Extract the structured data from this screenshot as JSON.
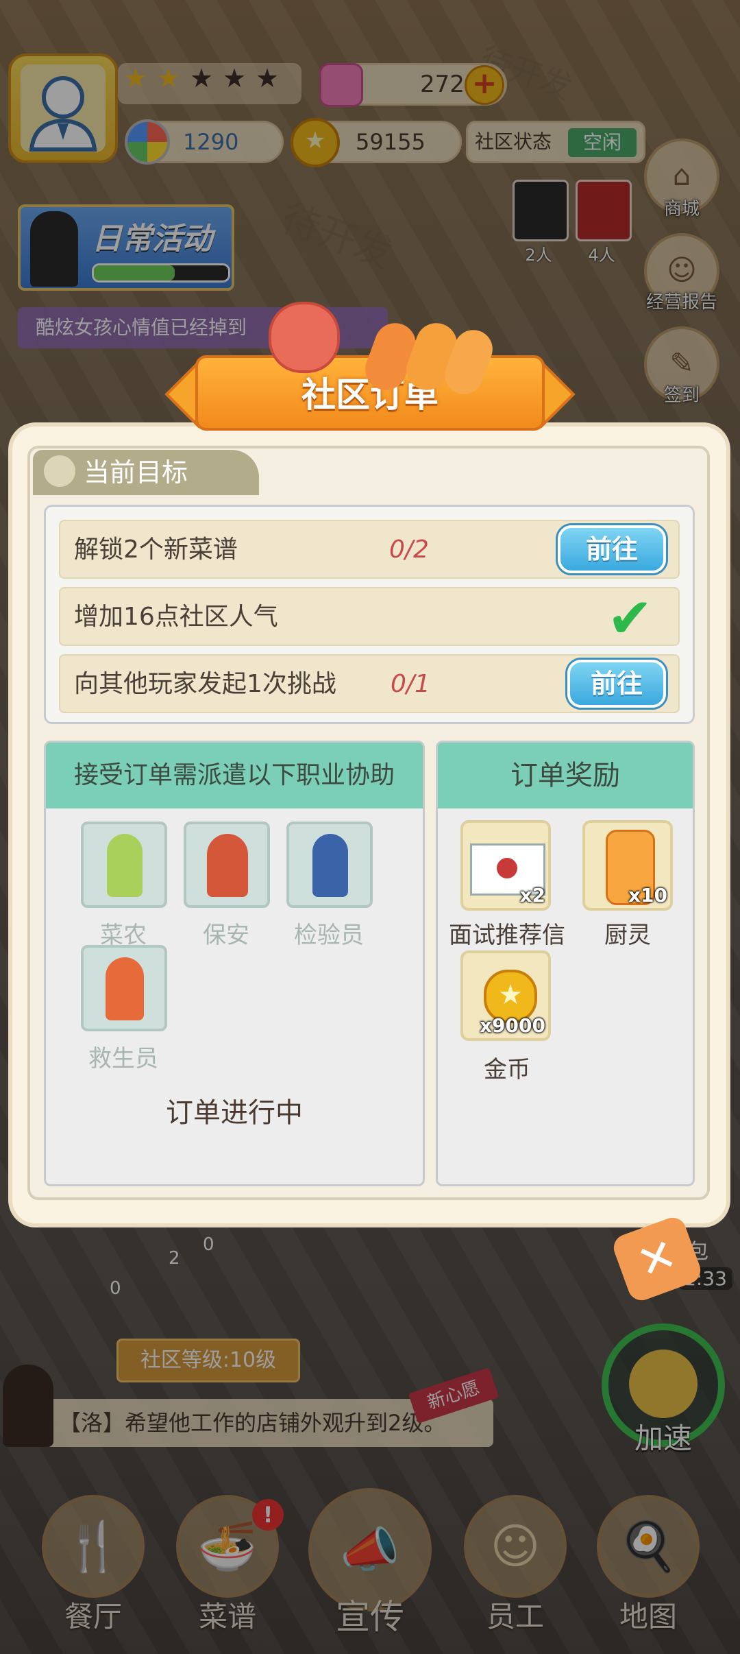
{
  "hud": {
    "gems": "272",
    "lottery": "1290",
    "coins": "59155",
    "community_status_label": "社区状态",
    "community_status_value": "空闲",
    "stars_filled": 1.5,
    "stars_total": 5,
    "daily_activity": "日常活动",
    "notice": "酷炫女孩心情值已经掉到"
  },
  "side": {
    "shop": "商城",
    "report": "经营报告",
    "signin": "签到",
    "staff_a_count": "2人",
    "staff_b_count": "4人"
  },
  "background_text": [
    "待开发",
    "待开发"
  ],
  "modal": {
    "title": "社区订单",
    "goal_tab": "当前目标",
    "goals": [
      {
        "text": "解锁2个新菜谱",
        "progress": "0/2",
        "button": "前往"
      },
      {
        "text": "增加16点社区人气",
        "done": true
      },
      {
        "text": "向其他玩家发起1次挑战",
        "progress": "0/1",
        "button": "前往"
      }
    ],
    "jobs_header": "接受订单需派遣以下职业协助",
    "jobs": [
      "菜农",
      "保安",
      "检验员",
      "救生员"
    ],
    "order_status": "订单进行中",
    "rewards_header": "订单奖励",
    "rewards": [
      {
        "name": "面试推荐信",
        "qty": "x2"
      },
      {
        "name": "厨灵",
        "qty": "x10"
      },
      {
        "name": "金币",
        "qty": "x9000"
      }
    ]
  },
  "under": {
    "community_level": "社区等级:10级",
    "wish": "【洛】希望他工作的店铺外观升到2级。",
    "wish_tag": "新心愿",
    "speed": "加速",
    "bag_partial": "包",
    "timer_partial": "1:33",
    "counter_0": "0",
    "counter_2": "2",
    "counter_0b": "0"
  },
  "nav": [
    "餐厅",
    "菜谱",
    "宣传",
    "员工",
    "地图"
  ]
}
